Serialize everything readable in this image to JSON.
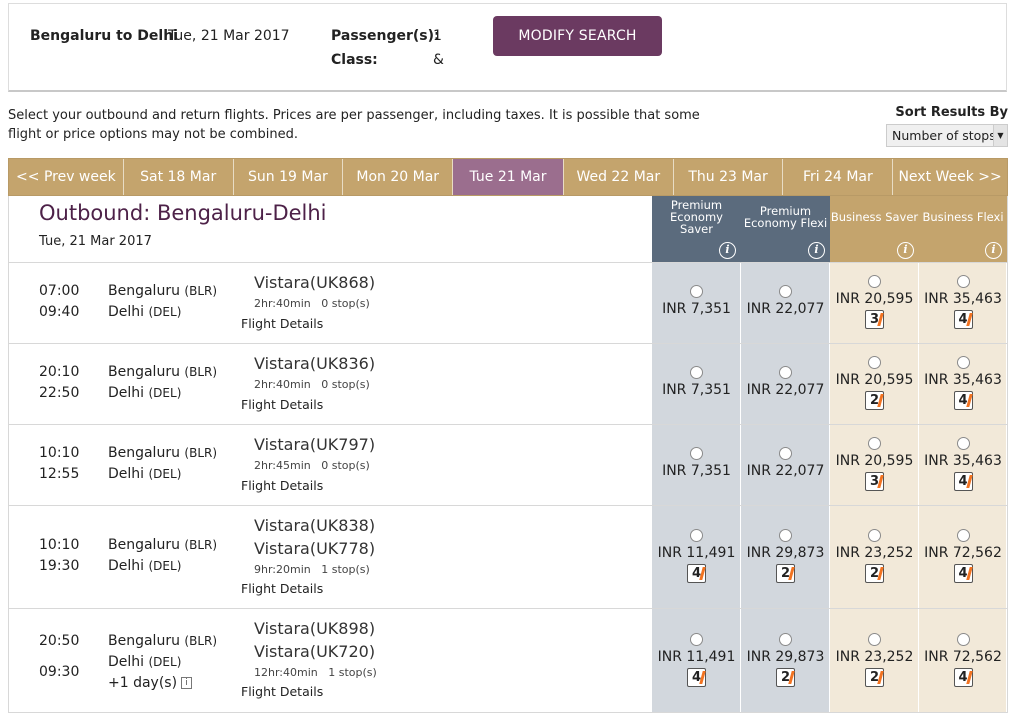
{
  "search": {
    "route": "Bengaluru to Delhi",
    "date": "Tue, 21 Mar 2017",
    "passengers_label": "Passenger(s):",
    "passengers_value": "1",
    "class_label": "Class:",
    "class_value": "&",
    "modify_label": "MODIFY SEARCH"
  },
  "info_text": "Select your outbound and return flights. Prices are per passenger, including taxes. It is possible that some flight or price options may not be combined.",
  "sort": {
    "label": "Sort Results By",
    "selected": "Number of stops"
  },
  "week_tabs": [
    {
      "label": "<< Prev week"
    },
    {
      "label": "Sat 18 Mar"
    },
    {
      "label": "Sun 19 Mar"
    },
    {
      "label": "Mon 20 Mar"
    },
    {
      "label": "Tue 21 Mar"
    },
    {
      "label": "Wed 22 Mar"
    },
    {
      "label": "Thu 23 Mar"
    },
    {
      "label": "Fri 24 Mar"
    },
    {
      "label": "Next Week >>"
    }
  ],
  "active_tab": "Tue 21 Mar",
  "outbound": {
    "title": "Outbound: Bengaluru-Delhi",
    "date": "Tue, 21 Mar 2017"
  },
  "fare_columns": [
    {
      "label": "Premium Economy Saver"
    },
    {
      "label": "Premium Economy Flexi"
    },
    {
      "label": "Business Saver"
    },
    {
      "label": "Business Flexi"
    }
  ],
  "flight_details_label": "Flight Details",
  "flights": [
    {
      "dep": "07:00",
      "arr": "09:40",
      "from": "Bengaluru",
      "from_code": "(BLR)",
      "to": "Delhi",
      "to_code": "(DEL)",
      "numbers": [
        "Vistara(UK868)"
      ],
      "duration": "2hr:40min",
      "stops": "0 stop(s)",
      "fares": [
        {
          "price": "INR 7,351",
          "seats": ""
        },
        {
          "price": "INR 22,077",
          "seats": ""
        },
        {
          "price": "INR 20,595",
          "seats": "3"
        },
        {
          "price": "INR 35,463",
          "seats": "4"
        }
      ]
    },
    {
      "dep": "20:10",
      "arr": "22:50",
      "from": "Bengaluru",
      "from_code": "(BLR)",
      "to": "Delhi",
      "to_code": "(DEL)",
      "numbers": [
        "Vistara(UK836)"
      ],
      "duration": "2hr:40min",
      "stops": "0 stop(s)",
      "fares": [
        {
          "price": "INR 7,351",
          "seats": ""
        },
        {
          "price": "INR 22,077",
          "seats": ""
        },
        {
          "price": "INR 20,595",
          "seats": "2"
        },
        {
          "price": "INR 35,463",
          "seats": "4"
        }
      ]
    },
    {
      "dep": "10:10",
      "arr": "12:55",
      "from": "Bengaluru",
      "from_code": "(BLR)",
      "to": "Delhi",
      "to_code": "(DEL)",
      "numbers": [
        "Vistara(UK797)"
      ],
      "duration": "2hr:45min",
      "stops": "0 stop(s)",
      "fares": [
        {
          "price": "INR 7,351",
          "seats": ""
        },
        {
          "price": "INR 22,077",
          "seats": ""
        },
        {
          "price": "INR 20,595",
          "seats": "3"
        },
        {
          "price": "INR 35,463",
          "seats": "4"
        }
      ]
    },
    {
      "dep": "10:10",
      "arr": "19:30",
      "from": "Bengaluru",
      "from_code": "(BLR)",
      "to": "Delhi",
      "to_code": "(DEL)",
      "numbers": [
        "Vistara(UK838)",
        "Vistara(UK778)"
      ],
      "duration": "9hr:20min",
      "stops": "1 stop(s)",
      "fares": [
        {
          "price": "INR 11,491",
          "seats": "4"
        },
        {
          "price": "INR 29,873",
          "seats": "2"
        },
        {
          "price": "INR 23,252",
          "seats": "2"
        },
        {
          "price": "INR 72,562",
          "seats": "4"
        }
      ]
    },
    {
      "dep": "20:50",
      "arr": "09:30",
      "from": "Bengaluru",
      "from_code": "(BLR)",
      "to": "Delhi",
      "to_code": "(DEL)",
      "next_day": "+1 day(s)",
      "numbers": [
        "Vistara(UK898)",
        "Vistara(UK720)"
      ],
      "duration": "12hr:40min",
      "stops": "1 stop(s)",
      "fares": [
        {
          "price": "INR 11,491",
          "seats": "4"
        },
        {
          "price": "INR 29,873",
          "seats": "2"
        },
        {
          "price": "INR 23,252",
          "seats": "2"
        },
        {
          "price": "INR 72,562",
          "seats": "4"
        }
      ]
    }
  ]
}
